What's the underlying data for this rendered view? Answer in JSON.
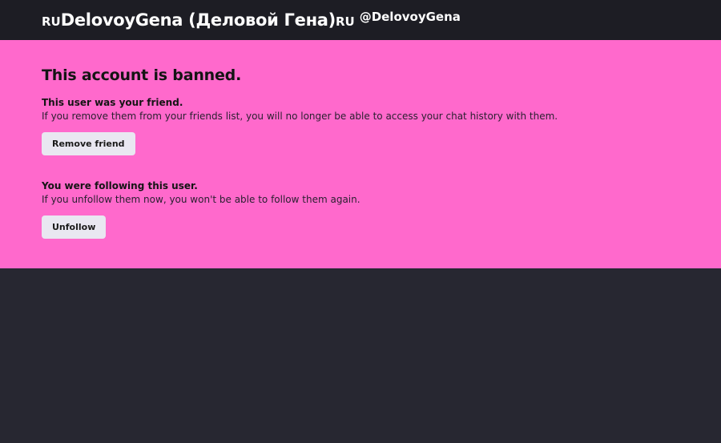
{
  "header": {
    "flag_left": "RU",
    "name": "DelovoyGena (Деловой Гена)",
    "flag_right": "RU",
    "handle": "@DelovoyGena"
  },
  "banner": {
    "title": "This account is banned.",
    "friend_section": {
      "title": "This user was your friend.",
      "description": "If you remove them from your friends list, you will no longer be able to access your chat history with them.",
      "button_label": "Remove friend"
    },
    "follow_section": {
      "title": "You were following this user.",
      "description": "If you unfollow them now, you won't be able to follow them again.",
      "button_label": "Unfollow"
    }
  },
  "colors": {
    "header_bg": "#1d1d24",
    "banner_bg": "#ff69cc",
    "page_bg": "#272731",
    "button_bg": "#e9e7f1"
  }
}
